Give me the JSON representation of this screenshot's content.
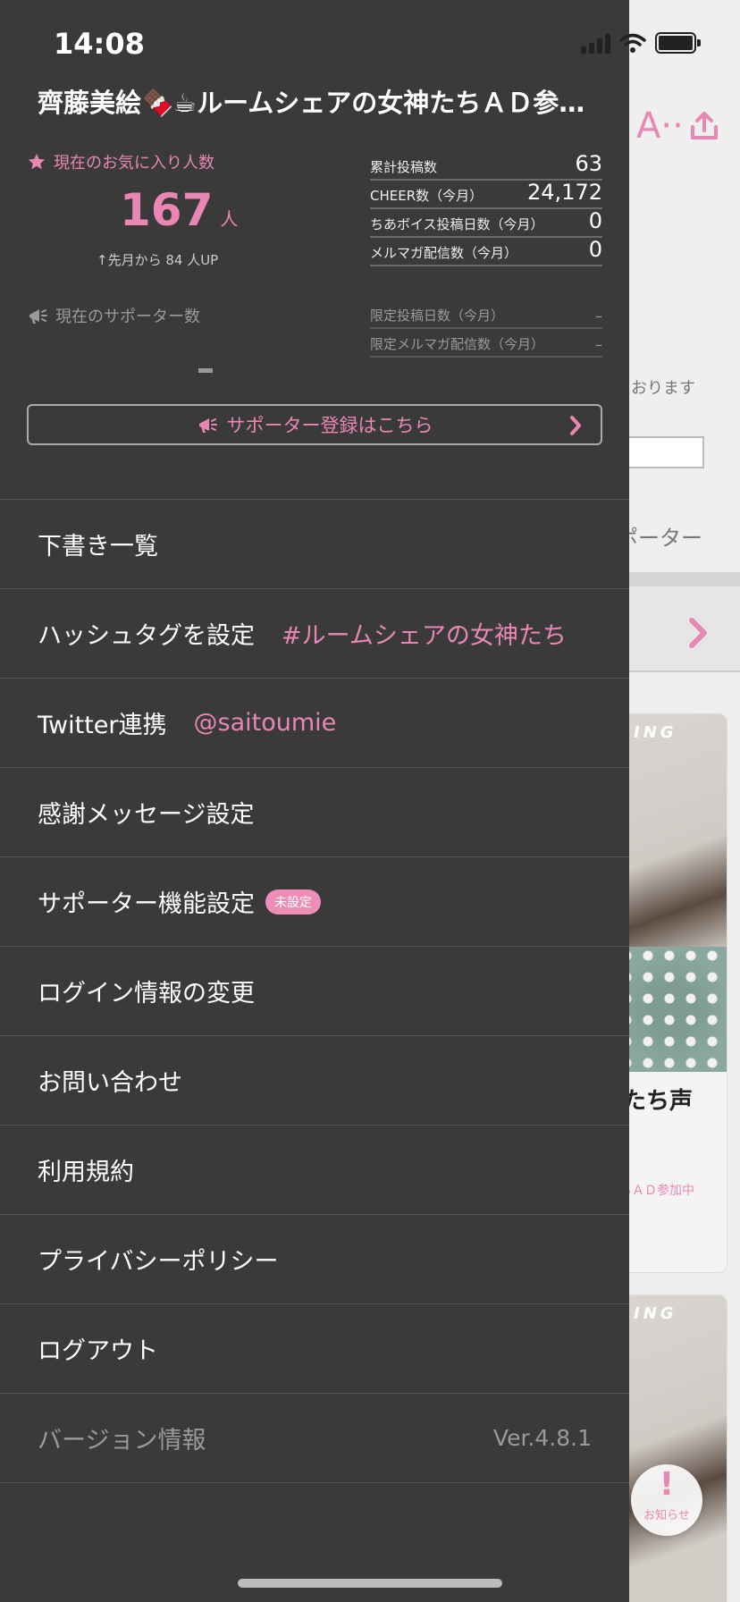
{
  "status_bar": {
    "time": "14:08"
  },
  "drawer": {
    "title": "齊藤美絵🍫☕ルームシェアの女神たちＡＤ参…",
    "favorites": {
      "label": "現在のお気に入り人数",
      "count": "167",
      "unit": "人",
      "change": "↑先月から 84 人UP"
    },
    "supporters": {
      "label": "現在のサポーター数"
    },
    "stats": [
      {
        "label": "累計投稿数",
        "value": "63"
      },
      {
        "label": "CHEER数（今月）",
        "value": "24,172"
      },
      {
        "label": "ちあボイス投稿日数（今月）",
        "value": "0"
      },
      {
        "label": "メルマガ配信数（今月）",
        "value": "0"
      }
    ],
    "limited_stats": [
      {
        "label": "限定投稿日数（今月）",
        "value": "–"
      },
      {
        "label": "限定メルマガ配信数（今月）",
        "value": "–"
      }
    ],
    "supporter_button": "サポーター登録はこちら",
    "menu": {
      "drafts": "下書き一覧",
      "hashtag": "ハッシュタグを設定",
      "hashtag_value": "#ルームシェアの女神たち",
      "twitter": "Twitter連携",
      "twitter_value": "@saitoumie",
      "thanks": "感謝メッセージ設定",
      "supporter_settings": "サポーター機能設定",
      "supporter_badge": "未設定",
      "login": "ログイン情報の変更",
      "contact": "お問い合わせ",
      "terms": "利用規約",
      "privacy": "プライバシーポリシー",
      "logout": "ログアウト",
      "version_label": "バージョン情報",
      "version_value": "Ver.4.8.1"
    }
  },
  "background": {
    "header_glyph": "A··",
    "text1": "おります",
    "text2": "ポーター",
    "card_label": "ING",
    "card_title": "たち声",
    "card_tag": "ちＡＤ参加中",
    "notify_label": "お知らせ"
  },
  "colors": {
    "accent": "#e887b3",
    "drawer_bg": "#3a3a3a"
  }
}
